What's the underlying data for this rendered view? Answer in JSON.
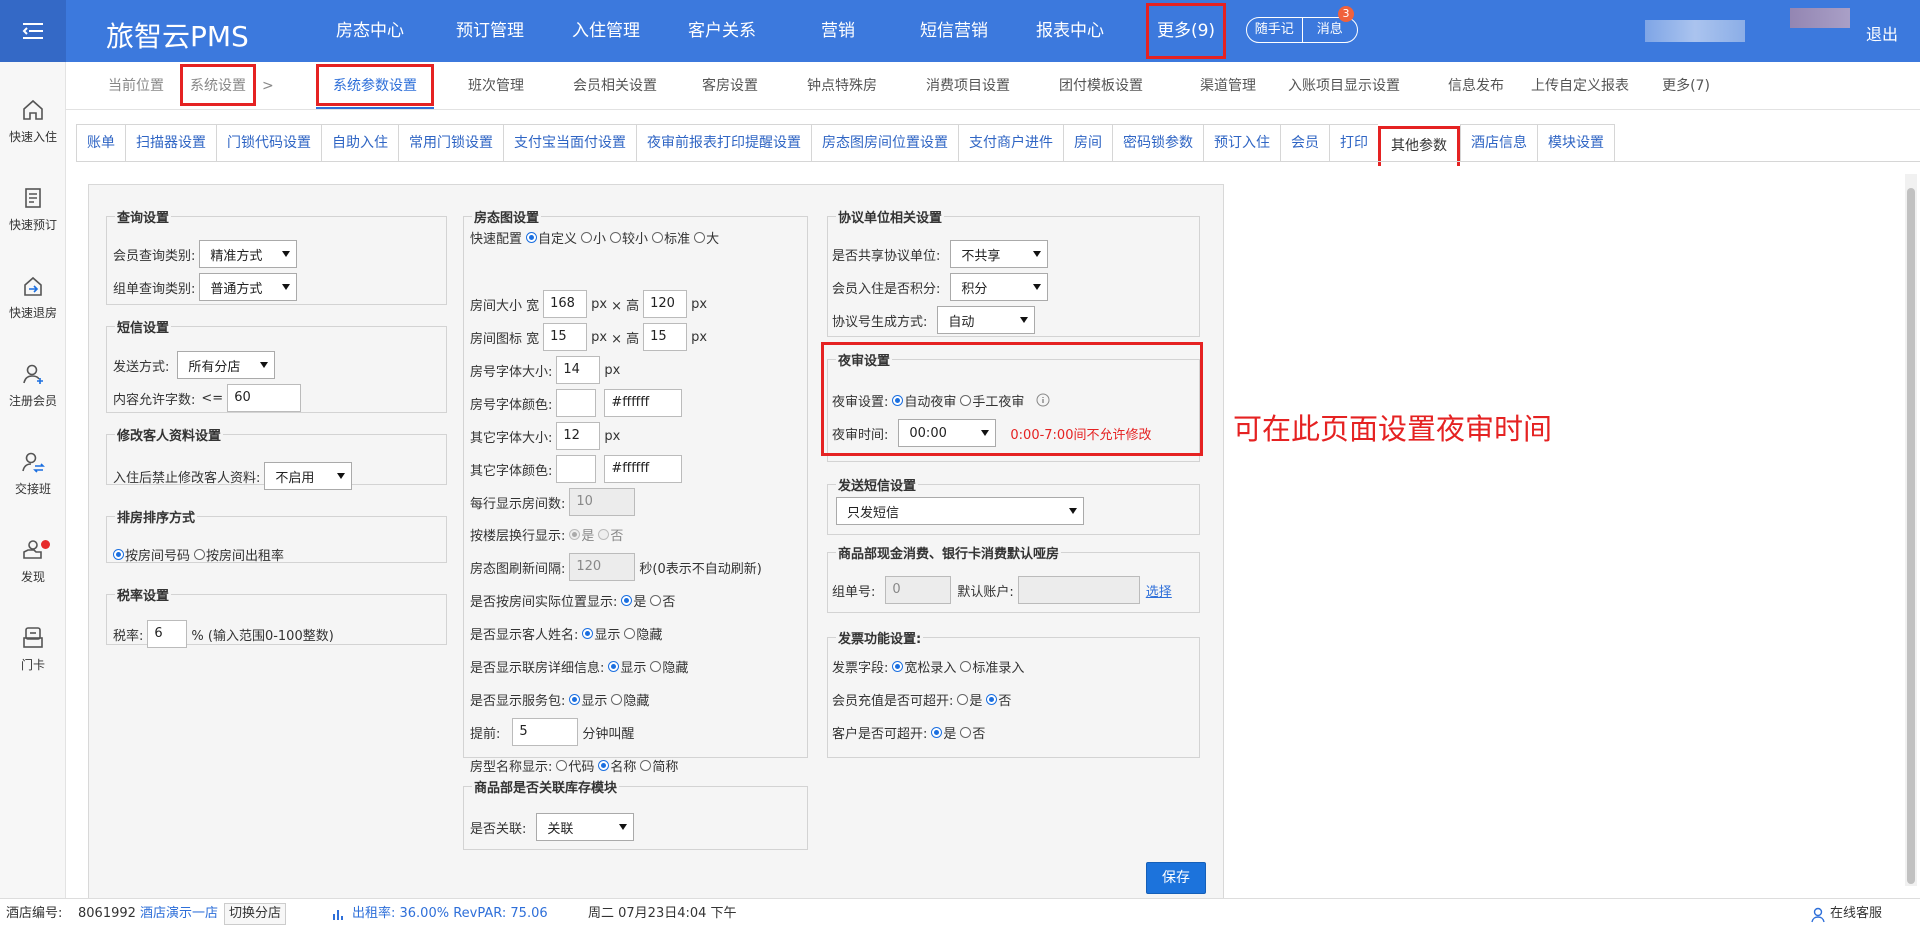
{
  "brand": "旅智云PMS",
  "nav": [
    "房态中心",
    "预订管理",
    "入住管理",
    "客户关系",
    "营销",
    "短信营销",
    "报表中心",
    "更多(9)"
  ],
  "pill": {
    "note": "随手记",
    "msg": "消息",
    "badge": "3"
  },
  "logout": "退出",
  "side": [
    "快速入住",
    "快速预订",
    "快速退房",
    "注册会员",
    "交接班",
    "发现",
    "门卡"
  ],
  "crumb": {
    "label": "当前位置",
    "sys": "系统设置",
    "sep": ">"
  },
  "toptabs": [
    "系统参数设置",
    "班次管理",
    "会员相关设置",
    "客房设置",
    "钟点特殊房",
    "消费项目设置",
    "团付模板设置",
    "渠道管理",
    "入账项目显示设置",
    "信息发布",
    "上传自定义报表",
    "更多(7)"
  ],
  "subtabs": [
    "账单",
    "扫描器设置",
    "门锁代码设置",
    "自助入住",
    "常用门锁设置",
    "支付宝当面付设置",
    "夜审前报表打印提醒设置",
    "房态图房间位置设置",
    "支付商户进件",
    "房间",
    "密码锁参数",
    "预订入住",
    "会员",
    "打印",
    "其他参数",
    "酒店信息",
    "模块设置"
  ],
  "query": {
    "title": "查询设置",
    "member_label": "会员查询类别:",
    "member_val": "精准方式",
    "group_label": "组单查询类别:",
    "group_val": "普通方式"
  },
  "sms": {
    "title": "短信设置",
    "send_label": "发送方式:",
    "send_val": "所有分店",
    "len_label": "内容允许字数:",
    "len_op": "<=",
    "len_val": "60"
  },
  "modify": {
    "title": "修改客人资料设置",
    "label": "入住后禁止修改客人资料:",
    "val": "不启用"
  },
  "sort": {
    "title": "排房排序方式",
    "opt1": "按房间号码",
    "opt2": "按房间出租率"
  },
  "tax": {
    "title": "税率设置",
    "label": "税率:",
    "val": "6",
    "hint": "% (输入范围0-100整数)"
  },
  "room": {
    "title": "房态图设置",
    "quick_label": "快速配置",
    "quick_opts": [
      "自定义",
      "小",
      "较小",
      "标准",
      "大"
    ],
    "size_label": "房间大小 宽",
    "size_w": "168",
    "px": "px",
    "times": "× 高",
    "size_h": "120",
    "icon_label": "房间图标 宽",
    "icon_w": "15",
    "icon_h": "15",
    "numfont_label": "房号字体大小:",
    "numfont_val": "14",
    "numcolor_label": "房号字体颜色:",
    "numcolor_val": "#ffffff",
    "otherfont_label": "其它字体大小:",
    "otherfont_val": "12",
    "othercolor_label": "其它字体颜色:",
    "othercolor_val": "#ffffff",
    "perrow_label": "每行显示房间数:",
    "perrow_val": "10",
    "floor_label": "按楼层换行显示:",
    "yes": "是",
    "no": "否",
    "refresh_label": "房态图刷新间隔:",
    "refresh_val": "120",
    "refresh_hint": "秒(0表示不自动刷新)",
    "pos_label": "是否按房间实际位置显示:",
    "guest_label": "是否显示客人姓名:",
    "show": "显示",
    "hide": "隐藏",
    "link_label": "是否显示联房详细信息:",
    "svc_label": "是否显示服务包:",
    "wake_label": "提前:",
    "wake_val": "5",
    "wake_hint": "分钟叫醒",
    "type_label": "房型名称显示:",
    "type_opts": [
      "代码",
      "名称",
      "简称"
    ]
  },
  "inventory": {
    "title": "商品部是否关联库存模块",
    "label": "是否关联:",
    "val": "关联"
  },
  "agreement": {
    "title": "协议单位相关设置",
    "share_label": "是否共享协议单位:",
    "share_val": "不共享",
    "points_label": "会员入住是否积分:",
    "points_val": "积分",
    "gen_label": "协议号生成方式:",
    "gen_val": "自动"
  },
  "night": {
    "title": "夜审设置",
    "mode_label": "夜审设置:",
    "auto": "自动夜审",
    "manual": "手工夜审",
    "time_label": "夜审时间:",
    "time_val": "00:00",
    "warn": "0:00-7:00间不允许修改"
  },
  "annotation": "可在此页面设置夜审时间",
  "sendsms": {
    "title": "发送短信设置",
    "val": "只发短信"
  },
  "goods": {
    "title": "商品部现金消费、银行卡消费默认哑房",
    "group_label": "组单号:",
    "group_val": "0",
    "acct_label": "默认账户:",
    "choose": "选择"
  },
  "invoice": {
    "title": "发票功能设置:",
    "field_label": "发票字段:",
    "loose": "宽松录入",
    "standard": "标准录入",
    "member_label": "会员充值是否可超开:",
    "cust_label": "客户是否可超开:",
    "yes": "是",
    "no": "否"
  },
  "save": "保存",
  "status": {
    "hotel_label": "酒店编号:",
    "hotel_no": "8061992",
    "hotel_name": "酒店演示一店",
    "switch": "切换分店",
    "occ": "出租率: 36.00% RevPAR: 75.06",
    "time": "周二 07月23日4:04 下午",
    "service": "在线客服"
  }
}
